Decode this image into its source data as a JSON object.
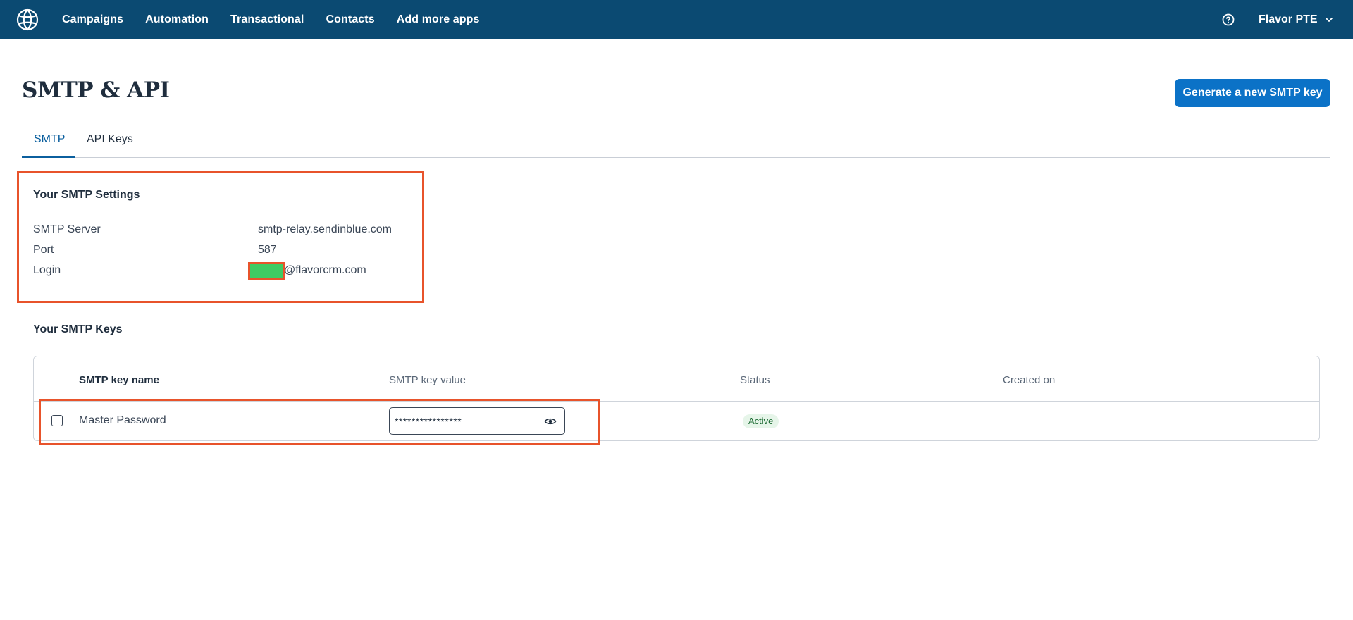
{
  "nav": {
    "logo_icon": "brand-logo-icon",
    "items": [
      {
        "label": "Campaigns"
      },
      {
        "label": "Automation"
      },
      {
        "label": "Transactional"
      },
      {
        "label": "Contacts"
      },
      {
        "label": "Add more apps"
      }
    ],
    "help_icon": "question-circle-icon",
    "account_name": "Flavor PTE",
    "account_icon": "chevron-down-icon"
  },
  "header": {
    "title": "SMTP & API",
    "generate_button": "Generate a new SMTP key"
  },
  "tabs": [
    {
      "label": "SMTP",
      "active": true
    },
    {
      "label": "API Keys",
      "active": false
    }
  ],
  "smtp_settings": {
    "title": "Your SMTP Settings",
    "rows": [
      {
        "label": "SMTP Server",
        "value": "smtp-relay.sendinblue.com"
      },
      {
        "label": "Port",
        "value": "587"
      },
      {
        "label": "Login",
        "value_domain": "@flavorcrm.com"
      }
    ]
  },
  "smtp_keys": {
    "title": "Your SMTP Keys",
    "columns": [
      "SMTP key name",
      "SMTP key value",
      "Status",
      "Created on"
    ],
    "rows": [
      {
        "name": "Master Password",
        "value": "****************",
        "status": "Active",
        "created_on": ""
      }
    ]
  },
  "colors": {
    "nav_bg": "#0b4a72",
    "primary": "#0b72c7",
    "highlight": "#e8532b",
    "mask": "#3fcb63"
  }
}
